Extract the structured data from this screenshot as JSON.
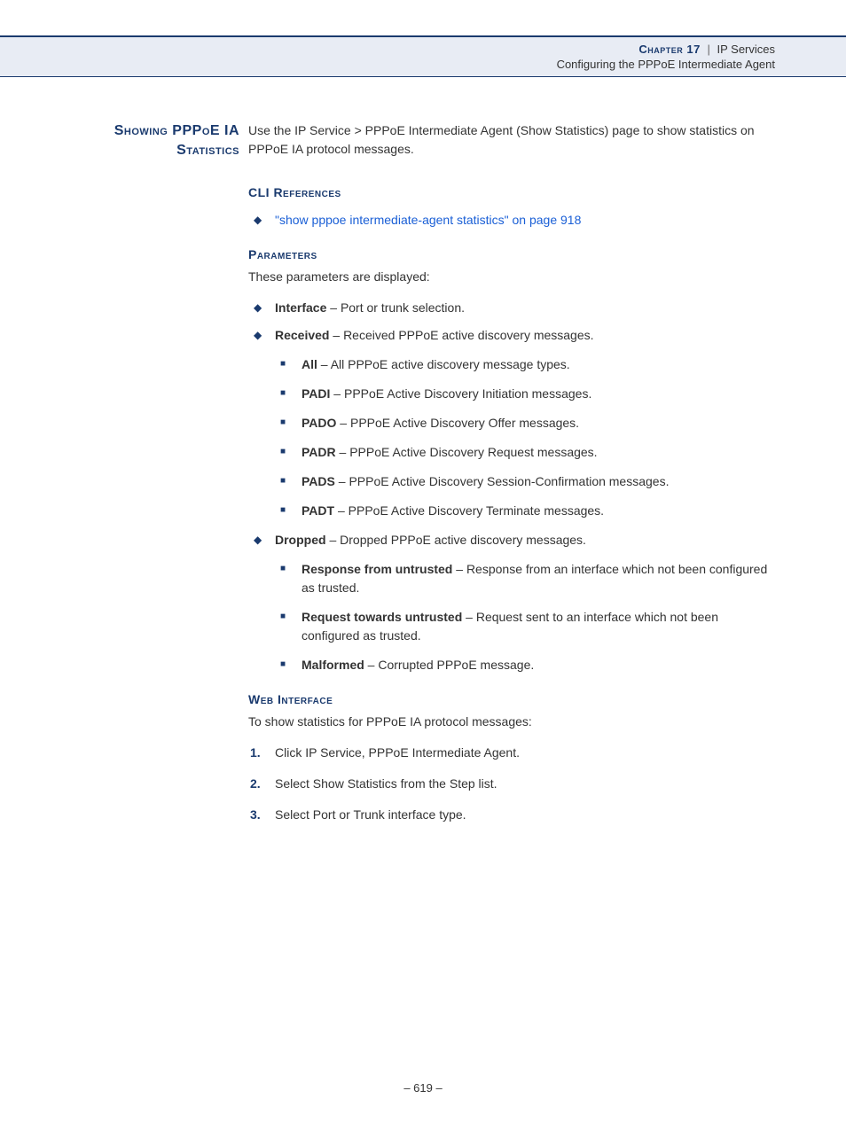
{
  "header": {
    "chapter_label": "Chapter 17",
    "separator": "|",
    "chapter_topic": "IP Services",
    "section": "Configuring the PPPoE Intermediate Agent"
  },
  "side_title": "Showing PPPoE IA Statistics",
  "intro": "Use the IP Service > PPPoE Intermediate Agent (Show Statistics) page to show statistics on PPPoE IA protocol messages.",
  "cli": {
    "heading": "CLI References",
    "link": "\"show pppoe intermediate-agent statistics\" on page 918"
  },
  "params": {
    "heading": "Parameters",
    "intro": "These parameters are displayed:",
    "items": [
      {
        "term": "Interface",
        "desc": "Port or trunk selection."
      },
      {
        "term": "Received",
        "desc": "Received PPPoE active discovery messages.",
        "sub": [
          {
            "term": "All",
            "desc": "All PPPoE active discovery message types."
          },
          {
            "term": "PADI",
            "desc": "PPPoE Active Discovery Initiation messages."
          },
          {
            "term": "PADO",
            "desc": "PPPoE Active Discovery Offer messages."
          },
          {
            "term": "PADR",
            "desc": "PPPoE Active Discovery Request messages."
          },
          {
            "term": "PADS",
            "desc": "PPPoE Active Discovery Session-Confirmation messages."
          },
          {
            "term": "PADT",
            "desc": "PPPoE Active Discovery Terminate messages."
          }
        ]
      },
      {
        "term": "Dropped",
        "desc": "Dropped PPPoE active discovery messages.",
        "sub": [
          {
            "term": "Response from untrusted",
            "desc": "Response from an interface which not been configured as trusted."
          },
          {
            "term": "Request towards untrusted",
            "desc": "Request sent to an interface which not been configured as trusted."
          },
          {
            "term": "Malformed",
            "desc": "Corrupted PPPoE message."
          }
        ]
      }
    ]
  },
  "web": {
    "heading": "Web Interface",
    "intro": "To show statistics for PPPoE IA protocol messages:",
    "steps": [
      "Click IP Service, PPPoE Intermediate Agent.",
      "Select Show Statistics from the Step list.",
      "Select Port or Trunk interface type."
    ]
  },
  "footer": "–  619  –"
}
